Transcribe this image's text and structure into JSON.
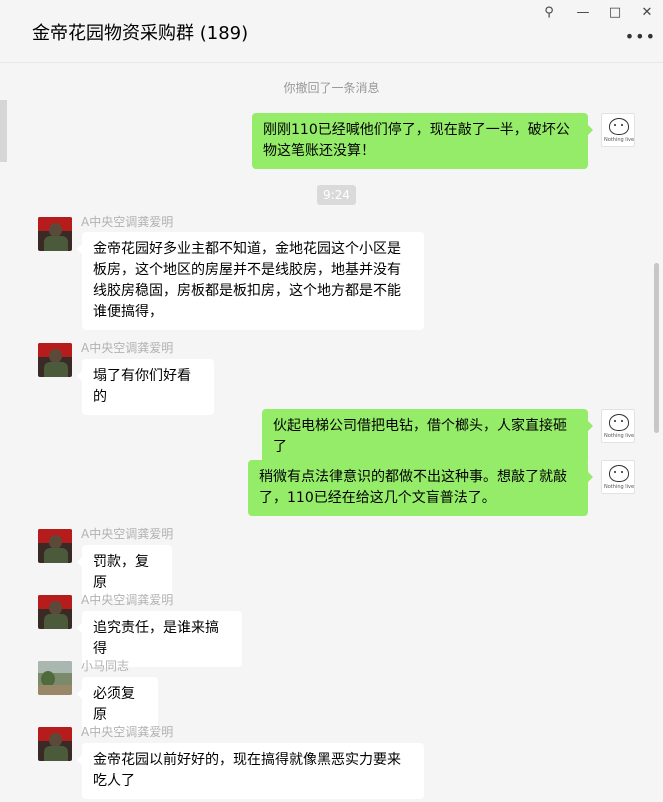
{
  "window": {
    "title": "金帝花园物资采购群 (189)",
    "pin_glyph": "⚲",
    "minimize_glyph": "—",
    "maximize_glyph": "□",
    "close_glyph": "✕",
    "more_glyph": "•••"
  },
  "system_notice": "你撤回了一条消息",
  "time_divider": "9:24",
  "self_avatar_caption": "Nothing lives",
  "messages": [
    {
      "text": "刚刚110已经喊他们停了，现在敲了一半，破坏公物这笔账还没算！"
    },
    {
      "sender": "A中央空调龚爱明",
      "text": "金帝花园好多业主都不知道，金地花园这个小区是板房，这个地区的房屋并不是线胶房，地基并没有线胶房稳固，房板都是板扣房，这个地方都是不能谁便搞得，"
    },
    {
      "sender": "A中央空调龚爱明",
      "text": "塌了有你们好看的"
    },
    {
      "text": "伙起电梯公司借把电钻，借个榔头，人家直接砸了"
    },
    {
      "text": "稍微有点法律意识的都做不出这种事。想敲了就敲了，110已经在给这几个文盲普法了。"
    },
    {
      "sender": "A中央空调龚爱明",
      "text": "罚款，复原"
    },
    {
      "sender": "A中央空调龚爱明",
      "text": "追究责任，是谁来搞得"
    },
    {
      "sender": "小马同志",
      "text": "必须复原"
    },
    {
      "sender": "A中央空调龚爱明",
      "text": "金帝花园以前好好的，现在搞得就像黑恶实力要来吃人了"
    }
  ]
}
